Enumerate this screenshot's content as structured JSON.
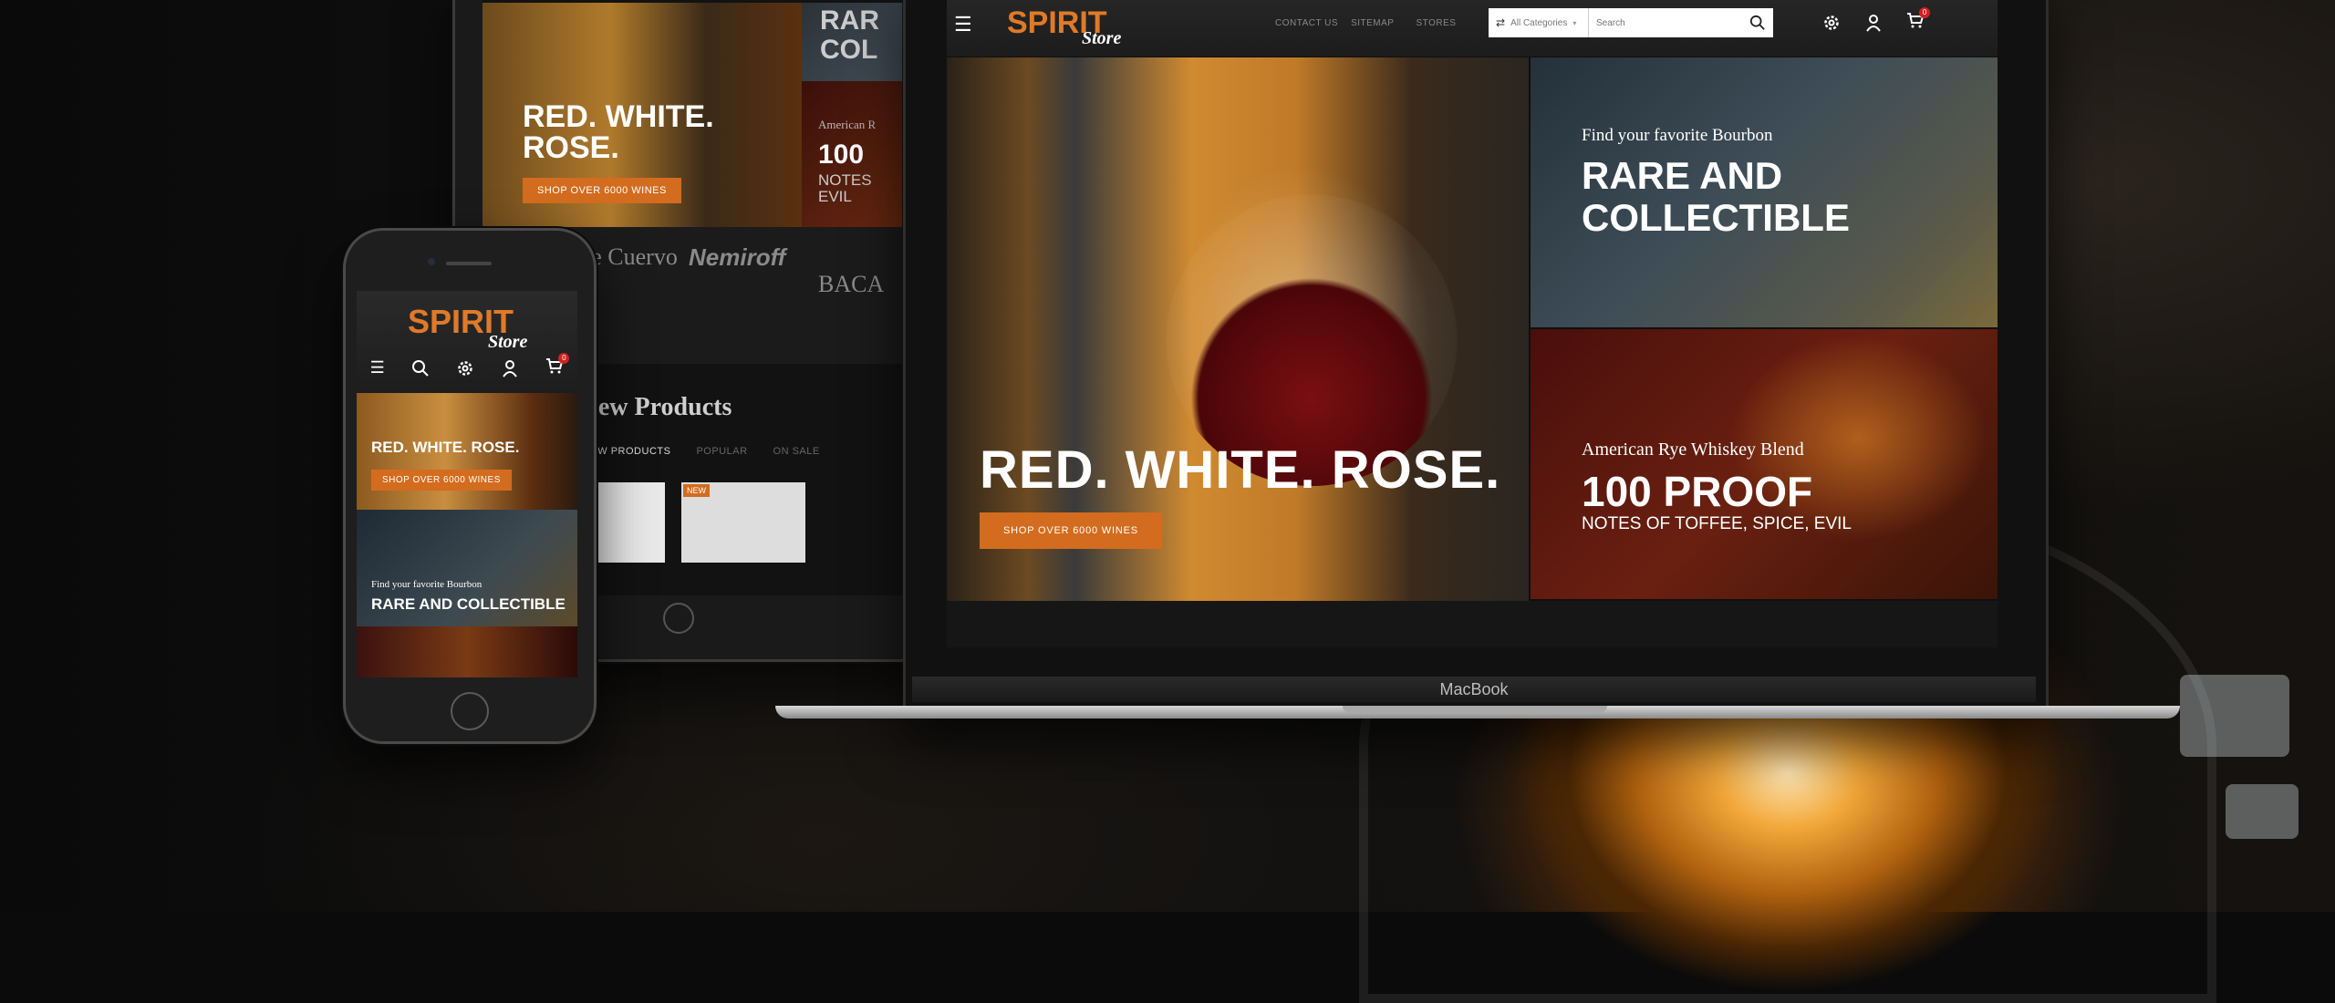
{
  "logo": {
    "word": "SPIRIT",
    "script": "Store"
  },
  "tablet": {
    "hero_title": "RED. WHITE. ROSE.",
    "hero_button": "SHOP OVER 6000 WINES",
    "rare_partial": "RAR",
    "rare_partial2": "COL",
    "american_partial": "American R",
    "proof_partial": "100",
    "notes_partial": "NOTES",
    "notes_partial2": "EVIL",
    "brands": [
      "Jose Cuervo",
      "Nemiroff",
      "BACA"
    ],
    "new_products_title": "New Products",
    "tabs": [
      "NEW PRODUCTS",
      "POPULAR",
      "ON SALE"
    ],
    "new_badge": "NEW"
  },
  "phone": {
    "hero_title": "RED. WHITE. ROSE.",
    "hero_button": "SHOP OVER 6000 WINES",
    "hero2_sub": "Find your favorite Bourbon",
    "hero2_title": "RARE AND COLLECTIBLE",
    "cart_count": "0"
  },
  "laptop": {
    "nav": [
      "CONTACT US",
      "SITEMAP",
      "STORES"
    ],
    "category_select": "All Categories",
    "search_placeholder": "Search",
    "cart_count": "0",
    "hero_title": "RED. WHITE. ROSE.",
    "hero_button": "SHOP OVER 6000 WINES",
    "tr_sub": "Find your favorite Bourbon",
    "tr_title_line1": "RARE AND",
    "tr_title_line2": "COLLECTIBLE",
    "br_sub": "American Rye Whiskey Blend",
    "br_title": "100 PROOF",
    "br_notes": "NOTES OF TOFFEE, SPICE, EVIL",
    "brand_label": "MacBook"
  },
  "colors": {
    "accent": "#d36c1e",
    "badge": "#d32020"
  }
}
